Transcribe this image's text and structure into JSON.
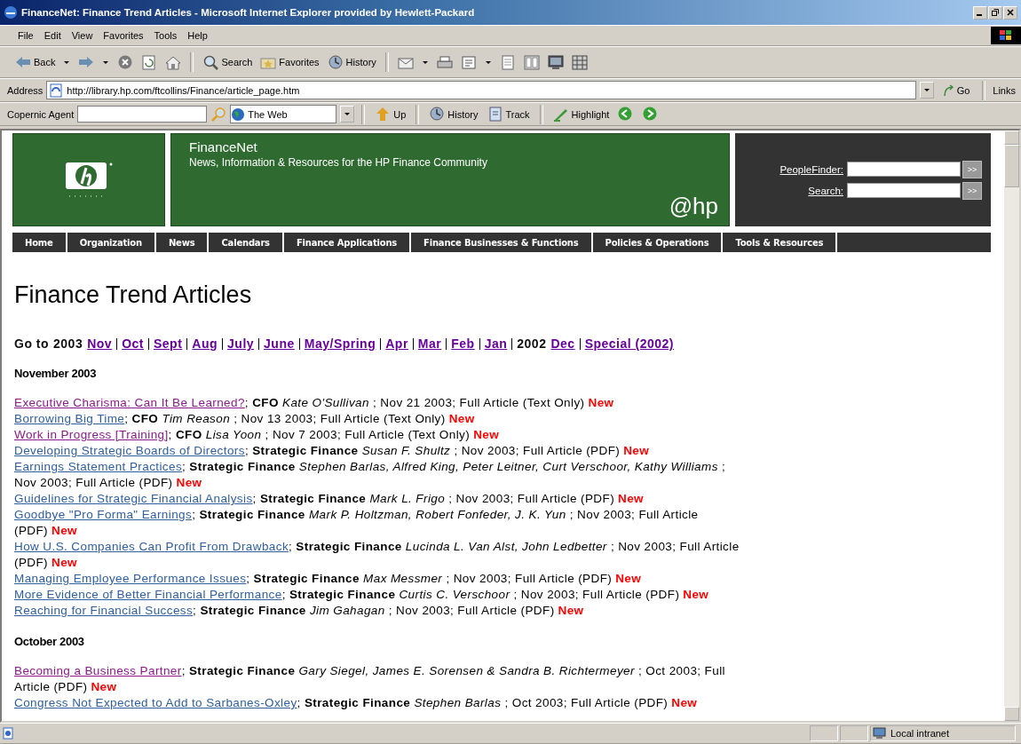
{
  "window": {
    "title": "FinanceNet: Finance Trend Articles - Microsoft Internet Explorer provided by Hewlett-Packard"
  },
  "menu": [
    "File",
    "Edit",
    "View",
    "Favorites",
    "Tools",
    "Help"
  ],
  "toolbar": [
    {
      "kind": "back",
      "label": "Back"
    },
    {
      "kind": "forward"
    },
    {
      "kind": "stop"
    },
    {
      "kind": "refresh"
    },
    {
      "kind": "home"
    },
    {
      "kind": "search",
      "label": "Search"
    },
    {
      "kind": "favorites",
      "label": "Favorites"
    },
    {
      "kind": "history",
      "label": "History"
    },
    {
      "kind": "mail"
    },
    {
      "kind": "print"
    },
    {
      "kind": "edit"
    },
    {
      "kind": "page"
    },
    {
      "kind": "panel"
    },
    {
      "kind": "messenger"
    },
    {
      "kind": "grid"
    }
  ],
  "address_bar": {
    "label": "Address",
    "url": "http://library.hp.com/ftcollins/Finance/article_page.htm",
    "go": "Go",
    "links": "Links"
  },
  "copernic_bar": {
    "label": "Copernic Agent",
    "scope": "The Web",
    "buttons": [
      {
        "kind": "up",
        "label": "Up"
      },
      {
        "kind": "history",
        "label": "History"
      },
      {
        "kind": "track",
        "label": "Track"
      },
      {
        "kind": "highlight",
        "label": "Highlight"
      },
      {
        "kind": "prev"
      },
      {
        "kind": "next"
      }
    ]
  },
  "site_header": {
    "site_name": "FinanceNet",
    "tagline": "News, Information & Resources for the HP Finance Community",
    "brand": "@hp",
    "search_rows": [
      {
        "label": "PeopleFinder:",
        "button": ">>"
      },
      {
        "label": "Search:",
        "button": ">>"
      }
    ]
  },
  "nav": [
    "Home",
    "Organization",
    "News",
    "Calendars",
    "Finance Applications",
    "Finance Businesses & Functions",
    "Policies & Operations",
    "Tools & Resources"
  ],
  "page": {
    "heading": "Finance Trend Articles",
    "goto": {
      "prefix": "Go to",
      "years": [
        {
          "year": "2003",
          "links": [
            "Nov",
            "Oct",
            "Sept",
            "Aug",
            "July",
            "June",
            "May/Spring",
            "Apr",
            "Mar",
            "Feb",
            "Jan"
          ]
        },
        {
          "year": "2002",
          "links": [
            "Dec",
            "Special (2002)"
          ]
        }
      ]
    },
    "sections": [
      {
        "title": "November 2003",
        "articles": [
          {
            "title": "Executive Charisma: Can It Be Learned?",
            "visited": true,
            "details": "; **CFO** *Kate O'Sullivan* ; Nov 21 2003; Full Article (Text Only)",
            "badge": "New"
          },
          {
            "title": "Borrowing Big Time",
            "visited": false,
            "details": "; **CFO** *Tim Reason* ; Nov 13 2003; Full Article (Text Only)",
            "badge": "New"
          },
          {
            "title": "Work in Progress [Training]",
            "visited": true,
            "details": "; **CFO** *Lisa Yoon* ; Nov 7 2003; Full Article (Text Only)",
            "badge": "New"
          },
          {
            "title": "Developing Strategic Boards of Directors",
            "visited": false,
            "details": "; **Strategic Finance** *Susan F. Shultz* ; Nov 2003; Full Article (PDF)",
            "badge": "New"
          },
          {
            "title": "Earnings Statement Practices",
            "visited": false,
            "details": "; **Strategic Finance** *Stephen Barlas, Alfred King, Peter Leitner, Curt Verschoor, Kathy Williams* ; Nov 2003; Full Article (PDF)",
            "badge": "New"
          },
          {
            "title": "Guidelines for Strategic Financial Analysis",
            "visited": false,
            "details": "; **Strategic Finance** *Mark L. Frigo* ; Nov 2003; Full Article (PDF)",
            "badge": "New"
          },
          {
            "title": "Goodbye \"Pro Forma\" Earnings",
            "visited": false,
            "details": "; **Strategic Finance** *Mark P. Holtzman, Robert Fonfeder, J. K. Yun* ; Nov 2003; Full Article (PDF)",
            "badge": "New"
          },
          {
            "title": "How U.S. Companies Can Profit From Drawback",
            "visited": false,
            "details": "; **Strategic Finance** *Lucinda L. Van Alst, John Ledbetter* ; Nov 2003; Full Article (PDF)",
            "badge": "New"
          },
          {
            "title": "Managing Employee Performance Issues",
            "visited": false,
            "details": "; **Strategic Finance** *Max Messmer* ; Nov 2003; Full Article (PDF)",
            "badge": "New"
          },
          {
            "title": "More Evidence of Better Financial Performance",
            "visited": false,
            "details": "; **Strategic Finance** *Curtis C. Verschoor* ; Nov 2003; Full Article (PDF)",
            "badge": "New"
          },
          {
            "title": "Reaching for Financial Success",
            "visited": false,
            "details": "; **Strategic Finance** *Jim Gahagan* ; Nov 2003; Full Article (PDF)",
            "badge": "New"
          }
        ]
      },
      {
        "title": "October 2003",
        "articles": [
          {
            "title": "Becoming a Business Partner",
            "visited": true,
            "details": "; **Strategic Finance** *Gary Siegel, James E. Sorensen & Sandra B. Richtermeyer* ; Oct 2003; Full Article (PDF)",
            "badge": "New"
          },
          {
            "title": "Congress Not Expected to Add to Sarbanes-Oxley",
            "visited": false,
            "details": "; **Strategic Finance** *Stephen Barlas* ; Oct 2003; Full Article (PDF)",
            "badge": "New"
          }
        ]
      }
    ]
  },
  "status_bar": {
    "zone": "Local intranet"
  }
}
